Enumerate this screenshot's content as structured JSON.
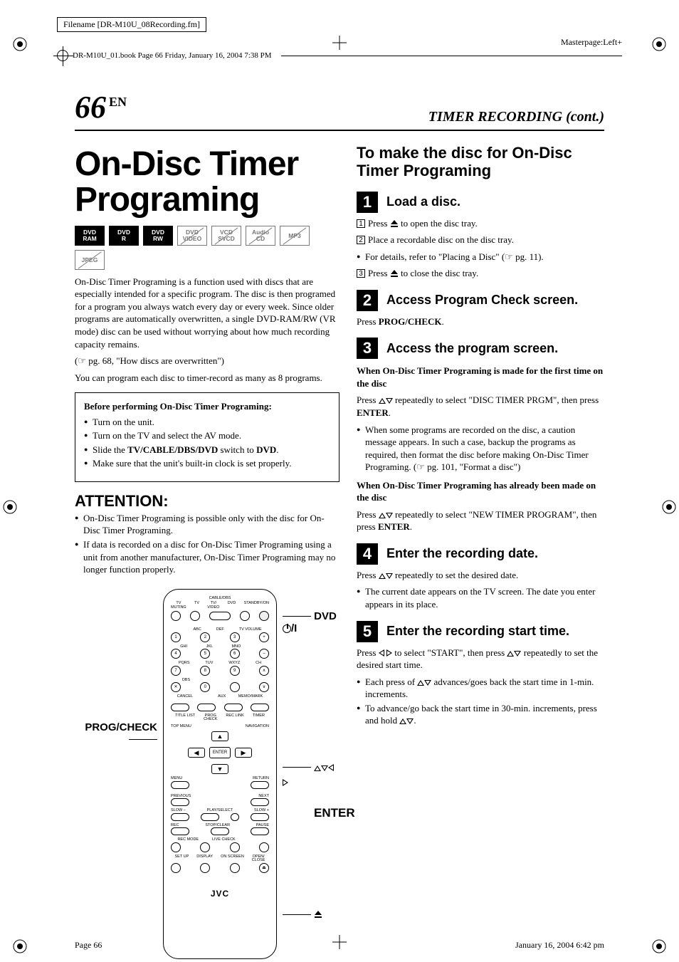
{
  "meta": {
    "filename_label": "Filename [DR-M10U_08Recording.fm]",
    "masterpage": "Masterpage:Left+",
    "book_line": "DR-M10U_01.book  Page 66  Friday, January 16, 2004  7:38 PM",
    "page_footer_left": "Page 66",
    "page_footer_right": "January 16, 2004 6:42 pm"
  },
  "header": {
    "page_number": "66",
    "lang": "EN",
    "section_title": "TIMER RECORDING (cont.)"
  },
  "left": {
    "title": "On-Disc Timer Programing",
    "badges": [
      "DVD\nRAM",
      "DVD\nR",
      "DVD\nRW",
      "DVD\nVIDEO",
      "VCD\nSVCD",
      "Audio\nCD",
      "MP3",
      "JPEG"
    ],
    "intro1": "On-Disc Timer Programing is a function used with discs that are especially intended for a specific program. The disc is then programed for a program you always watch every day or every week. Since older programs are automatically overwritten, a single DVD-RAM/RW (VR mode) disc can be used without worrying about how much recording capacity remains.",
    "intro_ref": "(☞ pg. 68, \"How discs are overwritten\")",
    "intro2": "You can program each disc to timer-record as many as 8 programs.",
    "prereq_heading": "Before performing On-Disc Timer Programing:",
    "prereq_items": [
      "Turn on the unit.",
      "Turn on the TV and select the AV mode.",
      "Slide the TV/CABLE/DBS/DVD switch to DVD.",
      "Make sure that the unit's built-in clock is set properly."
    ],
    "prereq_bold_a": "TV/CABLE/DBS/DVD",
    "prereq_bold_b": "DVD",
    "attention_heading": "ATTENTION:",
    "attention_items": [
      "On-Disc Timer Programing is possible only with the disc for On-Disc Timer Programing.",
      "If data is recorded on a disc for On-Disc Timer Programing using a unit from another manufacturer, On-Disc Timer Programing may no longer function properly."
    ],
    "remote_labels": {
      "dvd_power": "DVD⏻/I",
      "prog_check": "PROG/CHECK",
      "arrows_enter": "△▽◁▷\nENTER",
      "eject_label": "⏏"
    },
    "remote_logo": "JVC"
  },
  "right": {
    "subheading": "To make the disc for On-Disc Timer Programing",
    "steps": [
      {
        "num": "1",
        "label": "Load a disc.",
        "lines": [
          {
            "n": "1",
            "text_a": "Press ",
            "text_b": " to open the disc tray.",
            "icon": "eject"
          },
          {
            "n": "2",
            "text_a": "Place a recordable disc on the disc tray.",
            "text_b": "",
            "icon": ""
          }
        ],
        "bullets": [
          "For details, refer to \"Placing a Disc\" (☞ pg. 11)."
        ],
        "lines2": [
          {
            "n": "3",
            "text_a": "Press ",
            "text_b": " to close the disc tray.",
            "icon": "eject"
          }
        ]
      },
      {
        "num": "2",
        "label": "Access Program Check screen.",
        "body_a": "Press ",
        "body_bold": "PROG/CHECK",
        "body_b": "."
      },
      {
        "num": "3",
        "label": "Access the program screen.",
        "para_h1": "When On-Disc Timer Programing is made for the first time on the disc",
        "para1_a": "Press ",
        "para1_b": " repeatedly to select \"DISC TIMER PRGM\", then press ",
        "para1_bold": "ENTER",
        "para1_c": ".",
        "bullets1": [
          "When some programs are recorded on the disc, a caution message appears. In such a case, backup the programs as required, then format the disc before making On-Disc Timer Programing. (☞ pg. 101, \"Format a disc\")"
        ],
        "para_h2": "When On-Disc Timer Programing has already been made on the disc",
        "para2_a": "Press ",
        "para2_b": " repeatedly to select \"NEW TIMER PROGRAM\", then press ",
        "para2_bold": "ENTER",
        "para2_c": "."
      },
      {
        "num": "4",
        "label": "Enter the recording date.",
        "body_a": "Press ",
        "body_b": " repeatedly to set the desired date.",
        "bullets": [
          "The current date appears on the TV screen. The date you enter appears in its place."
        ]
      },
      {
        "num": "5",
        "label": "Enter the recording start time.",
        "body_a": "Press ",
        "body_b": " to select \"START\", then press ",
        "body_c": " repeatedly to set the desired start time.",
        "bullets": [
          "Each press of △▽ advances/goes back the start time in 1-min. increments.",
          "To advance/go back the start time in 30-min. increments, press and hold △▽."
        ]
      }
    ]
  }
}
